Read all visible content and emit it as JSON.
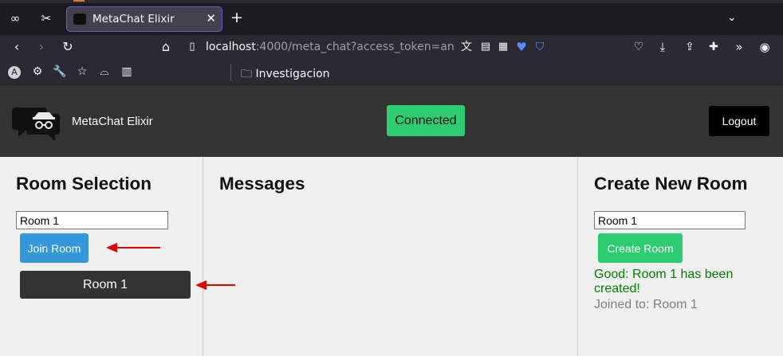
{
  "browser": {
    "tab_title": "MetaChat Elixir",
    "url_host": "localhost",
    "url_rest": ":4000/meta_chat?access_token=an",
    "bookmark_folder": "Investigacion"
  },
  "header": {
    "brand": "MetaChat Elixir",
    "status": "Connected",
    "logout_label": "Logout",
    "colors": {
      "bar": "#333333",
      "status": "#2ecc71",
      "logout": "#000000"
    }
  },
  "room_selection": {
    "title": "Room Selection",
    "input_value": "Room 1",
    "join_label": "Join Room",
    "rooms": [
      "Room 1"
    ]
  },
  "messages": {
    "title": "Messages"
  },
  "create_room": {
    "title": "Create New Room",
    "input_value": "Room 1",
    "create_label": "Create Room",
    "success_message": "Good: Room 1 has been created!",
    "joined_message": "Joined to: Room 1"
  },
  "icons": {
    "browser_tab": [
      "infinity-icon",
      "extension-puzzle-icon"
    ],
    "nav": [
      "back-icon",
      "forward-icon",
      "reload-icon",
      "home-icon",
      "page-icon"
    ],
    "toolbar": [
      "translate-icon",
      "reader-icon",
      "qr-icon",
      "heart-icon",
      "shield-icon",
      "pocket-icon",
      "download-icon",
      "share-icon",
      "extensions-icon",
      "overflow-icon",
      "firefox-icon"
    ],
    "annotations": [
      "red-arrow-icon"
    ]
  }
}
